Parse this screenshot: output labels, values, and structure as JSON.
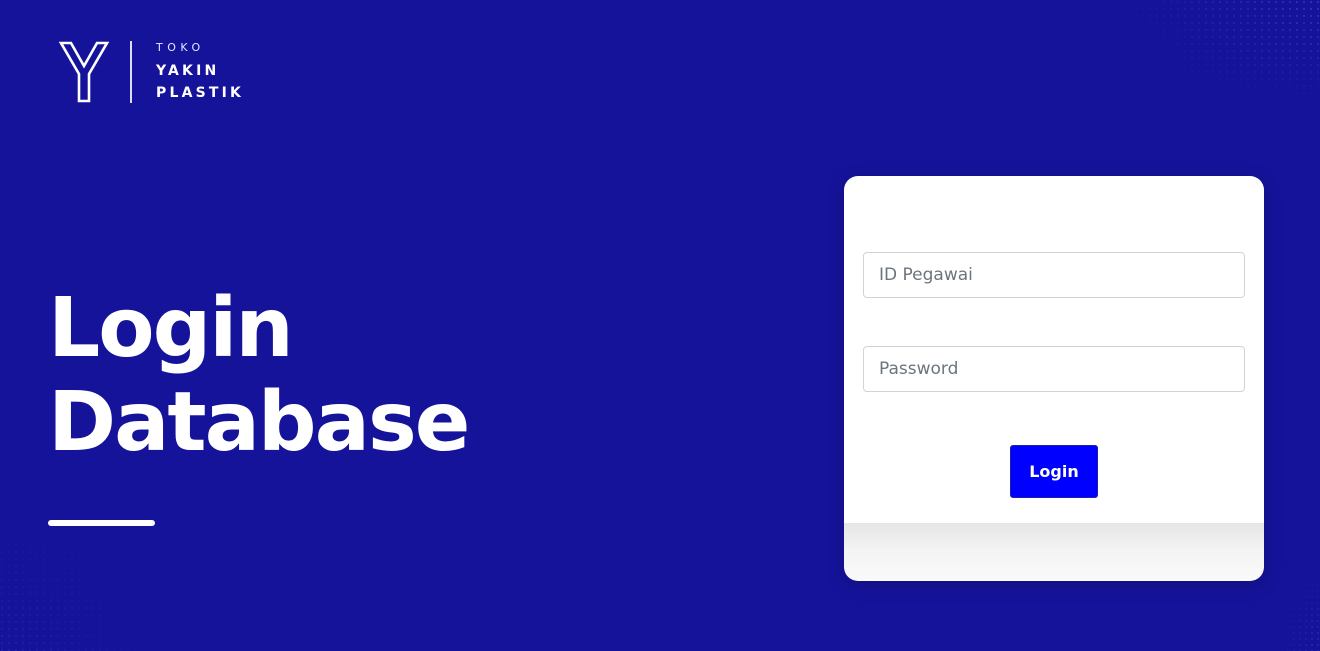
{
  "brand": {
    "line1": "TOKO",
    "line2": "YAKIN",
    "line3": "PLASTIK",
    "logo_icon": "y-letter-logo-icon"
  },
  "hero": {
    "line1": "Login",
    "line2": "Database"
  },
  "login_form": {
    "employee_id_placeholder": "ID Pegawai",
    "employee_id_value": "",
    "password_placeholder": "Password",
    "password_value": "",
    "submit_label": "Login"
  },
  "colors": {
    "background": "#15139a",
    "button": "#0000ff",
    "card": "#ffffff",
    "text_on_dark": "#ffffff"
  }
}
